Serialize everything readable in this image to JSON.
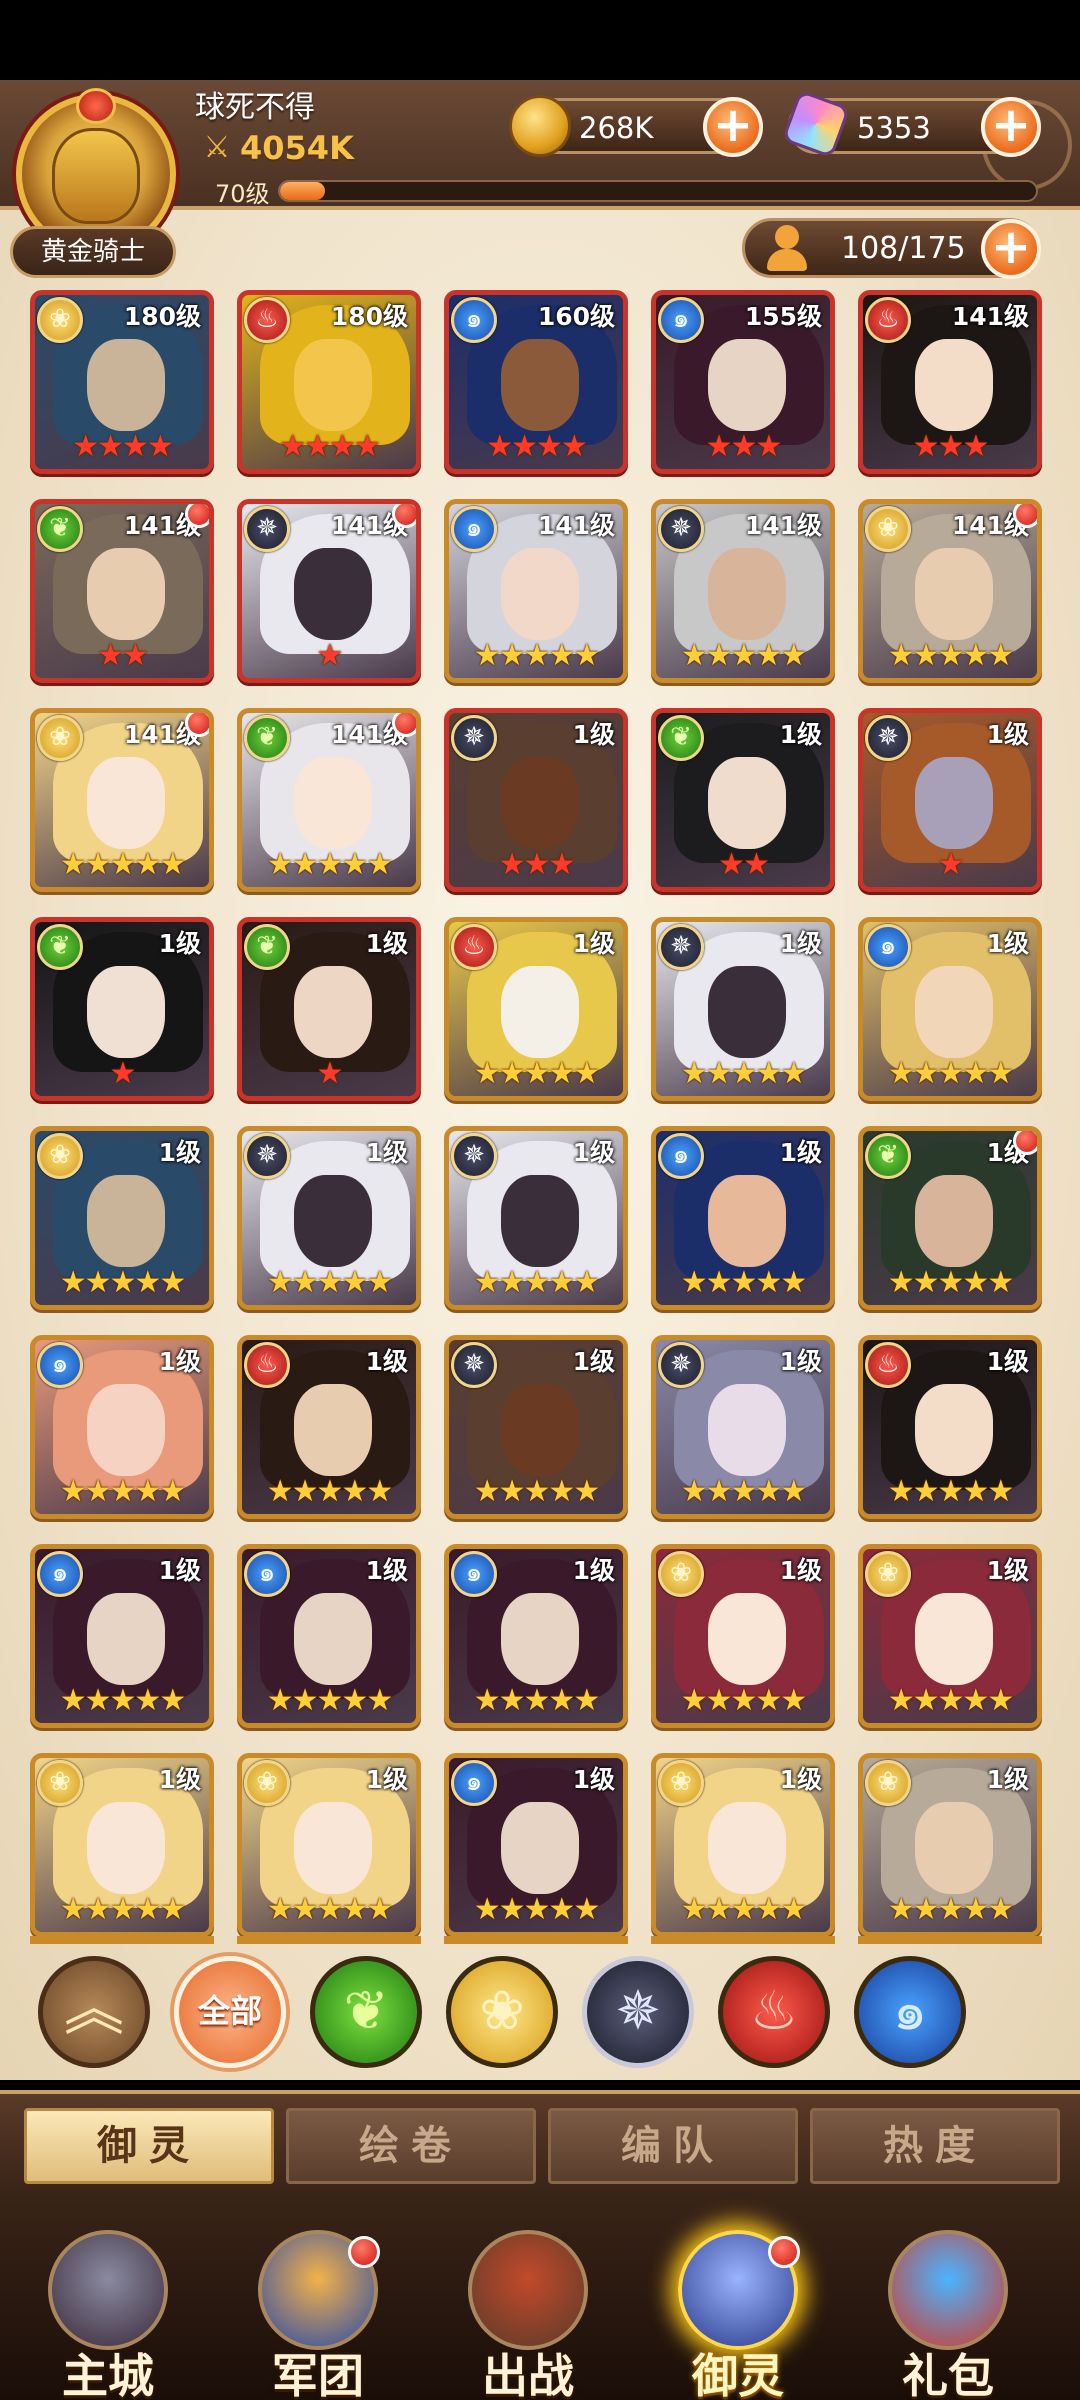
{
  "player": {
    "name": "球死不得",
    "power": "4054K",
    "level_label": "70级",
    "xp_fraction": 0.06,
    "title": "黄金骑士"
  },
  "resources": {
    "gold": "268K",
    "gems": "5353",
    "capacity": "108/175"
  },
  "icons": {
    "power": "crossed-swords-icon",
    "gold": "gold-coin-icon",
    "gem": "crystal-gem-icon",
    "capacity": "person-icon",
    "plus": "plus-icon"
  },
  "colors": {
    "frame_gold": "#c98a2a",
    "frame_red": "#c9342a",
    "star_gold": "#ffcf3a",
    "star_red": "#ff3a2a",
    "accent_orange": "#ea6b1d"
  },
  "heroes": [
    {
      "level": "180级",
      "faction": "gold",
      "stars": 4,
      "star_color": "red",
      "frame": "red",
      "dot": false,
      "skin": [
        "#2a4a6a",
        "#c9b49a"
      ]
    },
    {
      "level": "180级",
      "faction": "fire",
      "stars": 4,
      "star_color": "red",
      "frame": "red",
      "dot": false,
      "skin": [
        "#e2b31a",
        "#f3c64b"
      ]
    },
    {
      "level": "160级",
      "faction": "water",
      "stars": 4,
      "star_color": "red",
      "frame": "red",
      "dot": false,
      "skin": [
        "#1c2e6a",
        "#8a5a3a"
      ]
    },
    {
      "level": "155级",
      "faction": "water",
      "stars": 3,
      "star_color": "red",
      "frame": "red",
      "dot": false,
      "skin": [
        "#3a1a2a",
        "#e8d4c4"
      ]
    },
    {
      "level": "141级",
      "faction": "fire",
      "stars": 3,
      "star_color": "red",
      "frame": "red",
      "dot": false,
      "skin": [
        "#1c1614",
        "#f3dcc8"
      ]
    },
    {
      "level": "141级",
      "faction": "wind",
      "stars": 2,
      "star_color": "red",
      "frame": "red",
      "dot": true,
      "skin": [
        "#7a6a5a",
        "#e8ccb0"
      ]
    },
    {
      "level": "141级",
      "faction": "dark",
      "stars": 1,
      "star_color": "red",
      "frame": "red",
      "dot": true,
      "skin": [
        "#e8e8ee",
        "#3a2e3a"
      ]
    },
    {
      "level": "141级",
      "faction": "water",
      "stars": 5,
      "star_color": "gold",
      "frame": "gold",
      "dot": false,
      "skin": [
        "#d4d4dc",
        "#f2d8c8"
      ]
    },
    {
      "level": "141级",
      "faction": "dark",
      "stars": 5,
      "star_color": "gold",
      "frame": "gold",
      "dot": false,
      "skin": [
        "#c8c8c8",
        "#d8b49a"
      ]
    },
    {
      "level": "141级",
      "faction": "gold",
      "stars": 5,
      "star_color": "gold",
      "frame": "gold",
      "dot": true,
      "skin": [
        "#b8aa98",
        "#e8ccb0"
      ]
    },
    {
      "level": "141级",
      "faction": "gold",
      "stars": 5,
      "star_color": "gold",
      "frame": "gold",
      "dot": true,
      "skin": [
        "#f2d488",
        "#fae6d6"
      ]
    },
    {
      "level": "141级",
      "faction": "wind",
      "stars": 5,
      "star_color": "gold",
      "frame": "gold",
      "dot": true,
      "skin": [
        "#e8e6ea",
        "#fae6d6"
      ]
    },
    {
      "level": "1级",
      "faction": "dark",
      "stars": 3,
      "star_color": "red",
      "frame": "red",
      "dot": false,
      "skin": [
        "#5a3e30",
        "#6a3a22"
      ]
    },
    {
      "level": "1级",
      "faction": "wind",
      "stars": 2,
      "star_color": "red",
      "frame": "red",
      "dot": false,
      "skin": [
        "#1c1c1e",
        "#f0dccc"
      ]
    },
    {
      "level": "1级",
      "faction": "dark",
      "stars": 1,
      "star_color": "red",
      "frame": "red",
      "dot": false,
      "skin": [
        "#a65a2a",
        "#a8a0b8"
      ]
    },
    {
      "level": "1级",
      "faction": "wind",
      "stars": 1,
      "star_color": "red",
      "frame": "red",
      "dot": false,
      "skin": [
        "#151515",
        "#f0e0d4"
      ]
    },
    {
      "level": "1级",
      "faction": "wind",
      "stars": 1,
      "star_color": "red",
      "frame": "red",
      "dot": false,
      "skin": [
        "#2a1a14",
        "#eed6c4"
      ]
    },
    {
      "level": "1级",
      "faction": "fire",
      "stars": 5,
      "star_color": "gold",
      "frame": "gold",
      "dot": false,
      "skin": [
        "#e8c84a",
        "#f4f0e8"
      ]
    },
    {
      "level": "1级",
      "faction": "dark",
      "stars": 5,
      "star_color": "gold",
      "frame": "gold",
      "dot": false,
      "skin": [
        "#e8e8ee",
        "#3a2e3a"
      ]
    },
    {
      "level": "1级",
      "faction": "water",
      "stars": 5,
      "star_color": "gold",
      "frame": "gold",
      "dot": false,
      "skin": [
        "#e2c06a",
        "#f2d6b8"
      ]
    },
    {
      "level": "1级",
      "faction": "gold",
      "stars": 5,
      "star_color": "gold",
      "frame": "gold",
      "dot": false,
      "skin": [
        "#2a4a6a",
        "#c9b49a"
      ]
    },
    {
      "level": "1级",
      "faction": "dark",
      "stars": 5,
      "star_color": "gold",
      "frame": "gold",
      "dot": false,
      "skin": [
        "#e8e8ee",
        "#3a2e3a"
      ]
    },
    {
      "level": "1级",
      "faction": "dark",
      "stars": 5,
      "star_color": "gold",
      "frame": "gold",
      "dot": false,
      "skin": [
        "#e8e8ee",
        "#3a2e3a"
      ]
    },
    {
      "level": "1级",
      "faction": "water",
      "stars": 5,
      "star_color": "gold",
      "frame": "gold",
      "dot": false,
      "skin": [
        "#1c2e6a",
        "#e8b89a"
      ]
    },
    {
      "level": "1级",
      "faction": "wind",
      "stars": 5,
      "star_color": "gold",
      "frame": "gold",
      "dot": true,
      "skin": [
        "#2a3a2a",
        "#d8b49a"
      ]
    },
    {
      "level": "1级",
      "faction": "water",
      "stars": 5,
      "star_color": "gold",
      "frame": "gold",
      "dot": false,
      "skin": [
        "#e89a7a",
        "#f6d2c2"
      ]
    },
    {
      "level": "1级",
      "faction": "fire",
      "stars": 5,
      "star_color": "gold",
      "frame": "gold",
      "dot": false,
      "skin": [
        "#2a1a14",
        "#e8ccb0"
      ]
    },
    {
      "level": "1级",
      "faction": "dark",
      "stars": 5,
      "star_color": "gold",
      "frame": "gold",
      "dot": false,
      "skin": [
        "#5a3e30",
        "#6a3a22"
      ]
    },
    {
      "level": "1级",
      "faction": "dark",
      "stars": 5,
      "star_color": "gold",
      "frame": "gold",
      "dot": false,
      "skin": [
        "#8a8aa8",
        "#e8dce8"
      ]
    },
    {
      "level": "1级",
      "faction": "fire",
      "stars": 5,
      "star_color": "gold",
      "frame": "gold",
      "dot": false,
      "skin": [
        "#1c1614",
        "#f3dcc8"
      ]
    },
    {
      "level": "1级",
      "faction": "water",
      "stars": 5,
      "star_color": "gold",
      "frame": "gold",
      "dot": false,
      "skin": [
        "#3a1a2a",
        "#e8d4c4"
      ]
    },
    {
      "level": "1级",
      "faction": "water",
      "stars": 5,
      "star_color": "gold",
      "frame": "gold",
      "dot": false,
      "skin": [
        "#3a1a2a",
        "#e8d4c4"
      ]
    },
    {
      "level": "1级",
      "faction": "water",
      "stars": 5,
      "star_color": "gold",
      "frame": "gold",
      "dot": false,
      "skin": [
        "#3a1a2a",
        "#e8d4c4"
      ]
    },
    {
      "level": "1级",
      "faction": "gold",
      "stars": 5,
      "star_color": "gold",
      "frame": "gold",
      "dot": false,
      "skin": [
        "#8a2a3a",
        "#fae6d6"
      ]
    },
    {
      "level": "1级",
      "faction": "gold",
      "stars": 5,
      "star_color": "gold",
      "frame": "gold",
      "dot": false,
      "skin": [
        "#8a2a3a",
        "#fae6d6"
      ]
    },
    {
      "level": "1级",
      "faction": "gold",
      "stars": 5,
      "star_color": "gold",
      "frame": "gold",
      "dot": false,
      "skin": [
        "#f2d488",
        "#fae6d6"
      ]
    },
    {
      "level": "1级",
      "faction": "gold",
      "stars": 5,
      "star_color": "gold",
      "frame": "gold",
      "dot": false,
      "skin": [
        "#f2d488",
        "#fae6d6"
      ]
    },
    {
      "level": "1级",
      "faction": "water",
      "stars": 5,
      "star_color": "gold",
      "frame": "gold",
      "dot": false,
      "skin": [
        "#3a1a2a",
        "#e8d4c4"
      ]
    },
    {
      "level": "1级",
      "faction": "gold",
      "stars": 5,
      "star_color": "gold",
      "frame": "gold",
      "dot": false,
      "skin": [
        "#f2d488",
        "#fae6d6"
      ]
    },
    {
      "level": "1级",
      "faction": "gold",
      "stars": 5,
      "star_color": "gold",
      "frame": "gold",
      "dot": false,
      "skin": [
        "#b8aa98",
        "#e8ccb0"
      ]
    }
  ],
  "faction_icons": {
    "gold": "rose-emblem-icon",
    "fire": "phoenix-emblem-icon",
    "water": "wave-emblem-icon",
    "dark": "star-web-emblem-icon",
    "wind": "leaf-emblem-icon"
  },
  "filters": {
    "collapse_icon": "double-chevron-up-icon",
    "all_label": "全部",
    "factions": [
      "wind",
      "gold",
      "dark",
      "fire",
      "water"
    ]
  },
  "tabs": [
    {
      "label": "御灵",
      "active": true
    },
    {
      "label": "绘卷",
      "active": false
    },
    {
      "label": "编队",
      "active": false
    },
    {
      "label": "热度",
      "active": false
    }
  ],
  "nav": [
    {
      "label": "主城",
      "icon": "castle-icon",
      "active": false,
      "badge": false,
      "art": [
        "#8a8aa0",
        "#3a2a3a"
      ]
    },
    {
      "label": "军团",
      "icon": "legion-fist-icon",
      "active": false,
      "badge": true,
      "art": [
        "#f2b24a",
        "#2a4aa8"
      ]
    },
    {
      "label": "出战",
      "icon": "battle-gate-icon",
      "active": false,
      "badge": false,
      "art": [
        "#c24a2a",
        "#5a3a2a"
      ]
    },
    {
      "label": "御灵",
      "icon": "spirit-crystal-icon",
      "active": true,
      "badge": true,
      "art": [
        "#9ab4ff",
        "#2a3a8a"
      ]
    },
    {
      "label": "礼包",
      "icon": "gift-shop-icon",
      "active": false,
      "badge": false,
      "art": [
        "#4ab4ff",
        "#d03a2a"
      ]
    }
  ]
}
